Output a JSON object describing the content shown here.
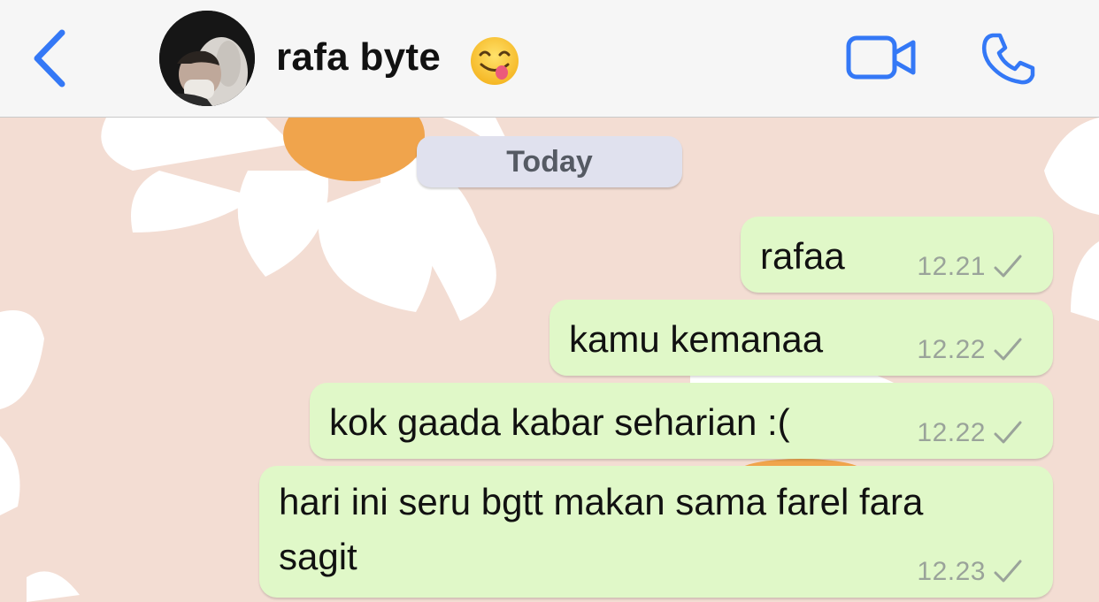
{
  "header": {
    "contact_name": "rafa byte",
    "emoji": "face-savoring-food",
    "accent_color": "#3478f6"
  },
  "date_chip": {
    "label": "Today"
  },
  "messages": [
    {
      "text": "rafaa",
      "time": "12.21",
      "status": "sent"
    },
    {
      "text": "kamu kemanaa",
      "time": "12.22",
      "status": "sent"
    },
    {
      "text": "kok gaada kabar seharian :(",
      "time": "12.22",
      "status": "sent"
    },
    {
      "text": "hari ini seru bgtt makan sama farel fara",
      "text_line2": "sagit",
      "time": "12.23",
      "status": "sent"
    }
  ]
}
